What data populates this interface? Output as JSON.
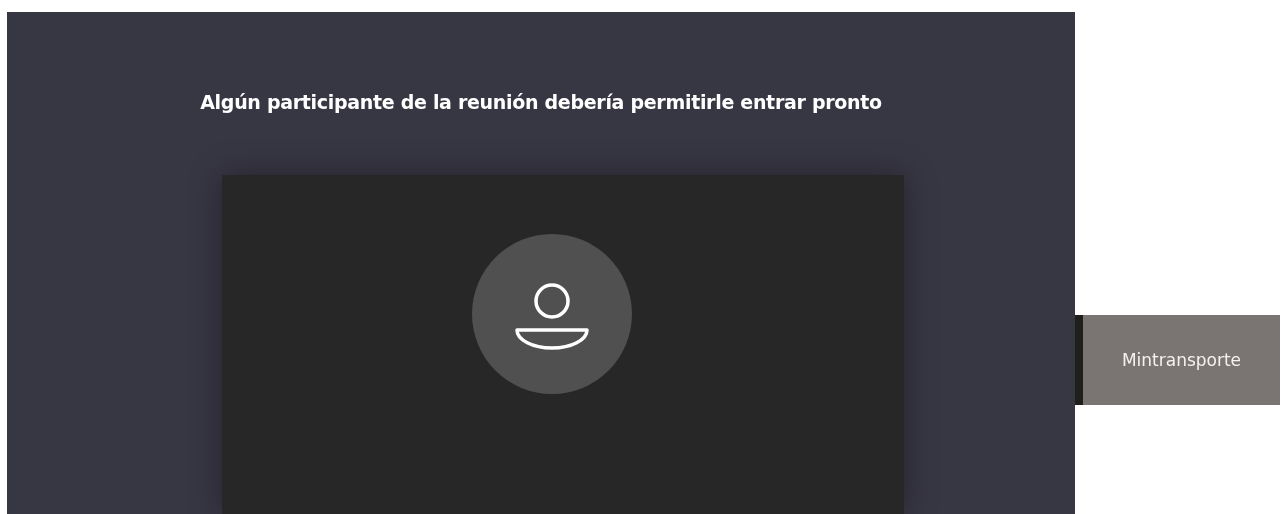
{
  "lobby": {
    "message": "Algún participante de la reunión debería permitirle entrar pronto"
  },
  "participant": {
    "name": "Mintransporte"
  }
}
